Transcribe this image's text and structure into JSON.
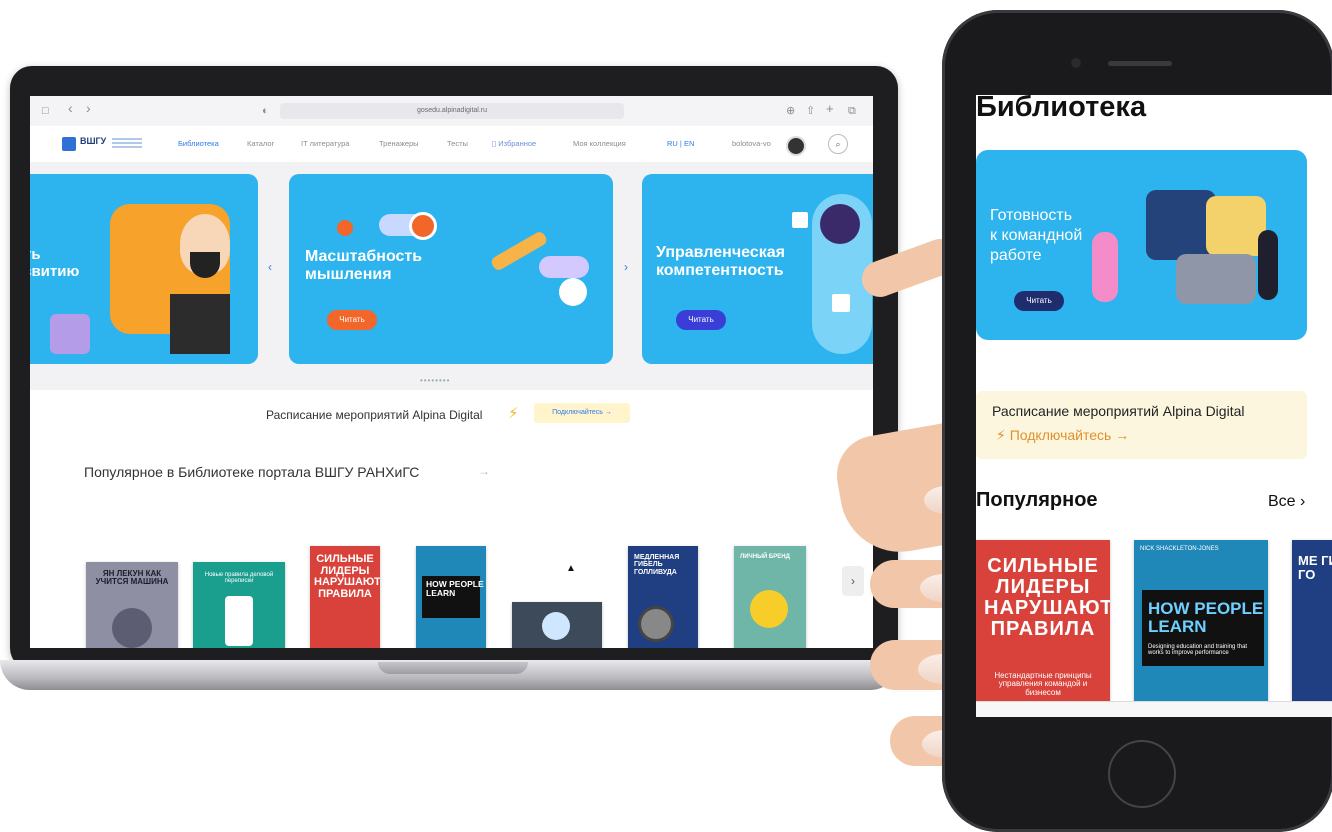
{
  "laptop": {
    "browser": {
      "url": "gosedu.alpinadigital.ru",
      "sidebar_icon": "□",
      "back_icon": "‹",
      "forward_icon": "›",
      "shield_icon": "◐",
      "download_icon": "⊕",
      "share_icon": "⇧",
      "newtab_icon": "+",
      "tabs_icon": "⧉"
    },
    "site": {
      "logo": "ВШГУ",
      "nav": [
        "Библиотека",
        "Каталог",
        "IT литература",
        "Тренажеры",
        "Тесты",
        "Избранное",
        "Моя коллекция"
      ],
      "lang": "RU | EN",
      "user": "bolotova-vo",
      "search_icon": "⌕"
    },
    "carousel": {
      "banners": [
        {
          "title_line1": "ть",
          "title_line2": "звитию"
        },
        {
          "title_line1": "Масштабность",
          "title_line2": "мышления",
          "button": "Читать"
        },
        {
          "title_line1": "Управленческая",
          "title_line2": "компетентность",
          "button": "Читать"
        }
      ],
      "prev_arrow": "‹",
      "next_arrow": "›",
      "dots": "••••••••"
    },
    "schedule": {
      "text": "Расписание мероприятий Alpina Digital",
      "bolt": "⚡",
      "button": "Подключайтесь →"
    },
    "popular": {
      "heading": "Популярное в Библиотеке портала ВШГУ РАНХиГС",
      "arrow": "→",
      "next_arrow": "›"
    },
    "books": [
      {
        "title": "ЯН ЛЕКУН КАК УЧИТСЯ МАШИНА",
        "color": "#8e8fa3",
        "text_color": "#1c1c2a"
      },
      {
        "title": "Новые правила деловой переписки",
        "color": "#1a9e8d",
        "text_color": "#ffffff"
      },
      {
        "title": "СИЛЬНЫЕ ЛИДЕРЫ НАРУШАЮТ ПРАВИЛА",
        "color": "#d9423a",
        "text_color": "#ffffff"
      },
      {
        "title": "HOW PEOPLE LEARN",
        "color": "#1f88b9",
        "text_color": "#ffffff"
      },
      {
        "title": "",
        "color": "#3d4a5a",
        "text_color": "#ffffff"
      },
      {
        "title": "МЕДЛЕННАЯ ГИБЕЛЬ ГОЛЛИВУДА",
        "color": "#1f3f82",
        "text_color": "#ffffff"
      },
      {
        "title": "ЛИЧНЫЙ БРЕНД",
        "color": "#6fb6a8",
        "text_color": "#ffffff"
      }
    ]
  },
  "phone": {
    "title": "Библиотека",
    "banner": {
      "title_line1": "Готовность",
      "title_line2": "к командной",
      "title_line3": "работе",
      "button": "Читать"
    },
    "schedule": {
      "text": "Расписание мероприятий Alpina Digital",
      "connect": "⚡ Подключайтесь →"
    },
    "popular": "Популярное",
    "all": "Все ›",
    "books": [
      {
        "title": "СИЛЬНЫЕ ЛИДЕРЫ НАРУШАЮТ ПРАВИЛА",
        "subtitle": "Нестандартные принципы управления командой и бизнесом",
        "color": "#d9423a"
      },
      {
        "title": "HOW PEOPLE LEARN",
        "subtitle": "Designing education and training that works to improve performance",
        "author": "NICK SHACKLETON-JONES",
        "color": "#1f88b9"
      },
      {
        "title": "МЕ ГИ ГО",
        "color": "#1f3f82"
      }
    ]
  }
}
